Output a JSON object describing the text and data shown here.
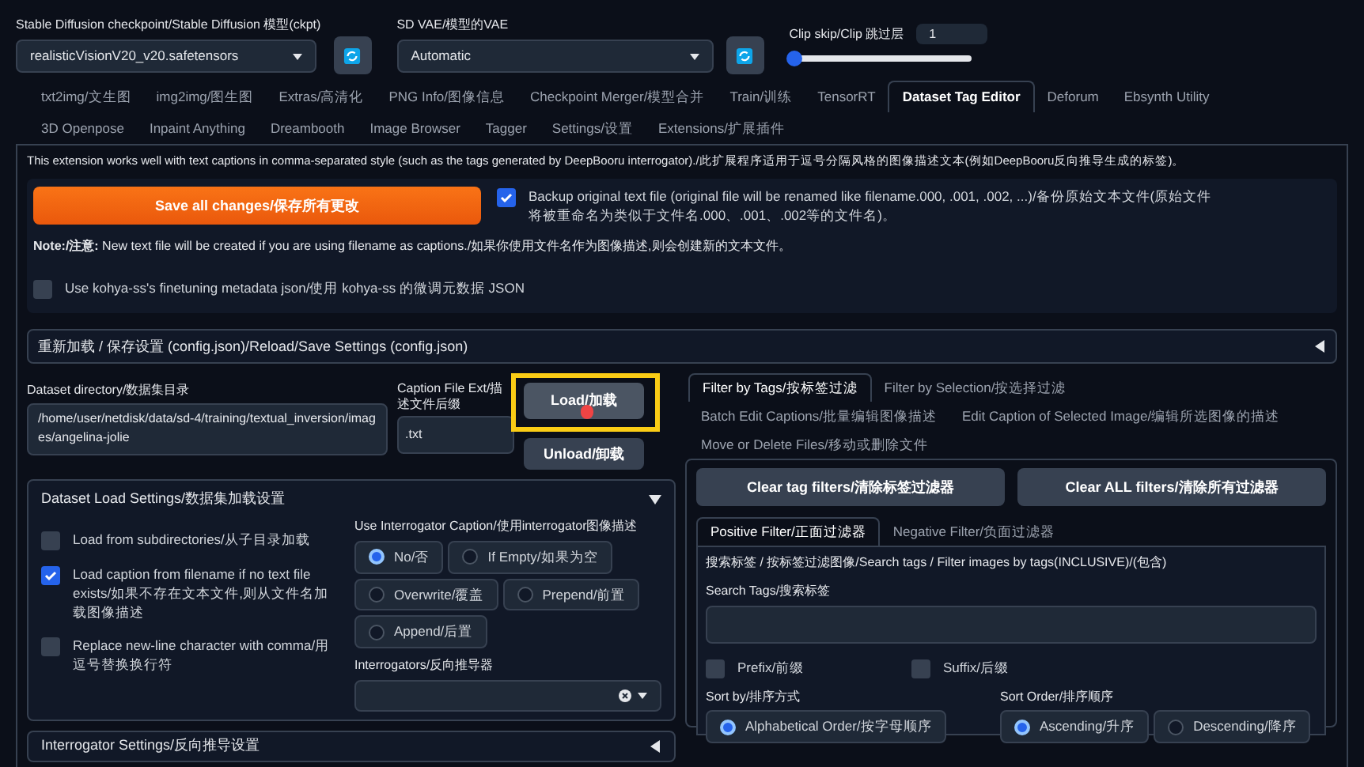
{
  "top": {
    "checkpoint": {
      "label": "Stable Diffusion checkpoint/Stable Diffusion 模型(ckpt)",
      "value": "realisticVisionV20_v20.safetensors"
    },
    "vae": {
      "label": "SD VAE/模型的VAE",
      "value": "Automatic"
    },
    "clip_skip": {
      "label": "Clip skip/Clip 跳过层",
      "value": "1",
      "level": 0
    }
  },
  "tabs": [
    {
      "label": "txt2img/文生图",
      "selected": false
    },
    {
      "label": "img2img/图生图",
      "selected": false
    },
    {
      "label": "Extras/高清化",
      "selected": false
    },
    {
      "label": "PNG Info/图像信息",
      "selected": false
    },
    {
      "label": "Checkpoint Merger/模型合并",
      "selected": false
    },
    {
      "label": "Train/训练",
      "selected": false
    },
    {
      "label": "TensorRT",
      "selected": false
    },
    {
      "label": "Dataset Tag Editor",
      "selected": true
    },
    {
      "label": "Deforum",
      "selected": false
    },
    {
      "label": "Ebsynth Utility",
      "selected": false
    },
    {
      "label": "3D Openpose",
      "selected": false
    },
    {
      "label": "Inpaint Anything",
      "selected": false
    },
    {
      "label": "Dreambooth",
      "selected": false
    },
    {
      "label": "Image Browser",
      "selected": false
    },
    {
      "label": "Tagger",
      "selected": false
    },
    {
      "label": "Settings/设置",
      "selected": false
    },
    {
      "label": "Extensions/扩展插件",
      "selected": false
    }
  ],
  "description": "This extension works well with text captions in comma-separated style (such as the tags generated by DeepBooru interrogator)./此扩展程序适用于逗号分隔风格的图像描述文本(例如DeepBooru反向推导生成的标签)。",
  "save_button": "Save all changes/保存所有更改",
  "backup_checkbox": {
    "label": "Backup original text file (original file will be renamed like filename.000, .001, .002, ...)/备份原始文本文件(原始文件将被重命名为类似于文件名.000、.001、.002等的文件名)。",
    "checked": true
  },
  "note": "**Note:/注意:** New text file will be created if you are using filename as captions./如果你使用文件名作为图像描述,则会创建新的文本文件。",
  "kohya_checkbox": {
    "label": "Use kohya-ss's finetuning metadata json/使用 kohya-ss 的微调元数据 JSON",
    "checked": false
  },
  "reload_accordion": {
    "title": "重新加载 / 保存设置 (config.json)/Reload/Save Settings (config.json)",
    "expanded": false
  },
  "dataset_dir": {
    "label": "Dataset directory/数据集目录",
    "value": "/home/user/netdisk/data/sd-4/training/textual_inversion/images/angelina-jolie"
  },
  "caption_ext": {
    "label": "Caption File Ext/描述文件后缀",
    "value": ".txt"
  },
  "load_button": "Load/加载",
  "unload_button": "Unload/卸载",
  "load_settings": {
    "title": "Dataset Load Settings/数据集加载设置",
    "expanded": true,
    "checkboxes": [
      {
        "label": "Load from subdirectories/从子目录加载",
        "checked": false
      },
      {
        "label": "Load caption from filename if no text file exists/如果不存在文本文件,则从文件名加载图像描述",
        "checked": true
      },
      {
        "label": "Replace new-line character with comma/用逗号替换换行符",
        "checked": false
      }
    ],
    "interrogator_caption": {
      "label": "Use Interrogator Caption/使用interrogator图像描述",
      "options": [
        {
          "label": "No/否",
          "selected": true
        },
        {
          "label": "If Empty/如果为空",
          "selected": false
        },
        {
          "label": "Overwrite/覆盖",
          "selected": false
        },
        {
          "label": "Prepend/前置",
          "selected": false
        },
        {
          "label": "Append/后置",
          "selected": false
        }
      ]
    },
    "interrogators_label": "Interrogators/反向推导器"
  },
  "interrogator_settings": {
    "title": "Interrogator Settings/反向推导设置",
    "expanded": false
  },
  "filter_tabs": [
    {
      "label": "Filter by Tags/按标签过滤",
      "selected": true
    },
    {
      "label": "Filter by Selection/按选择过滤",
      "selected": false
    },
    {
      "label": "Batch Edit Captions/批量编辑图像描述",
      "selected": false
    },
    {
      "label": "Edit Caption of Selected Image/编辑所选图像的描述",
      "selected": false
    },
    {
      "label": "Move or Delete Files/移动或删除文件",
      "selected": false
    }
  ],
  "clear_buttons": [
    "Clear tag filters/清除标签过滤器",
    "Clear ALL filters/清除所有过滤器"
  ],
  "filter_subtabs": [
    {
      "label": "Positive Filter/正面过滤器",
      "selected": true
    },
    {
      "label": "Negative Filter/负面过滤器",
      "selected": false
    }
  ],
  "filter_panel": {
    "title": "搜索标签 / 按标签过滤图像/Search tags / Filter images by tags(INCLUSIVE)/(包含)",
    "search_label": "Search Tags/搜索标签",
    "options": [
      {
        "label": "Prefix/前缀",
        "checked": false
      },
      {
        "label": "Suffix/后缀",
        "checked": false
      }
    ],
    "sort_by": {
      "label": "Sort by/排序方式",
      "options": [
        {
          "label": "Alphabetical Order/按字母顺序",
          "selected": true
        }
      ]
    },
    "sort_order": {
      "label": "Sort Order/排序顺序",
      "options": [
        {
          "label": "Ascending/升序",
          "selected": true
        },
        {
          "label": "Descending/降序",
          "selected": false
        }
      ]
    }
  }
}
